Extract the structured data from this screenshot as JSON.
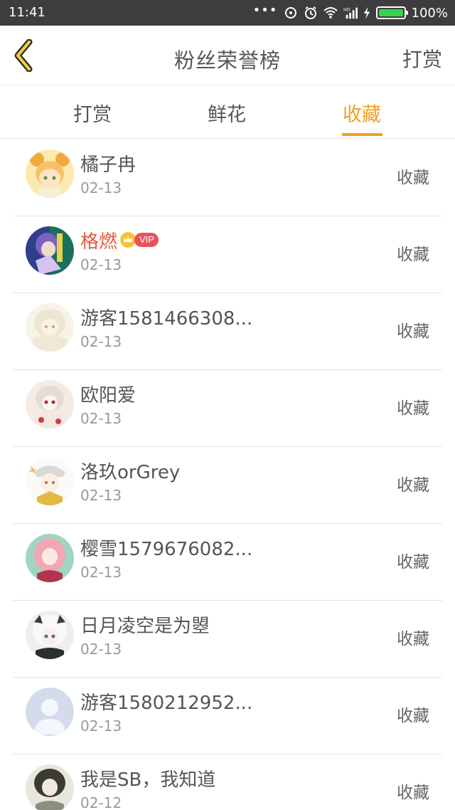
{
  "status_bar": {
    "time": "11:41",
    "dots": "•••",
    "battery_percent": "100%",
    "battery_color": "#39d353",
    "icons": [
      "hotspot-icon",
      "alarm-icon",
      "wifi-icon",
      "hd-signal-icon",
      "charging-icon",
      "battery-icon"
    ]
  },
  "header": {
    "title": "粉丝荣誉榜",
    "action_label": "打赏",
    "back_icon": "chevron-left-icon"
  },
  "tabs": [
    {
      "label": "打赏"
    },
    {
      "label": "鲜花"
    },
    {
      "label": "收藏",
      "active": true
    }
  ],
  "accent_color": "#f0a020",
  "rows": [
    {
      "name": "橘子冉",
      "date": "02-13",
      "action": "收藏"
    },
    {
      "name": "格燃",
      "date": "02-13",
      "action": "收藏",
      "vip": true,
      "vip_label": "VIP"
    },
    {
      "name": "游客1581466308...",
      "date": "02-13",
      "action": "收藏"
    },
    {
      "name": "欧阳爱",
      "date": "02-13",
      "action": "收藏"
    },
    {
      "name": "洛玖orGrey",
      "date": "02-13",
      "action": "收藏"
    },
    {
      "name": "樱雪1579676082...",
      "date": "02-13",
      "action": "收藏"
    },
    {
      "name": "日月凌空是为曌",
      "date": "02-13",
      "action": "收藏"
    },
    {
      "name": "游客1580212952...",
      "date": "02-13",
      "action": "收藏"
    },
    {
      "name": "我是SB，我知道",
      "date": "02-12",
      "action": "收藏"
    }
  ]
}
